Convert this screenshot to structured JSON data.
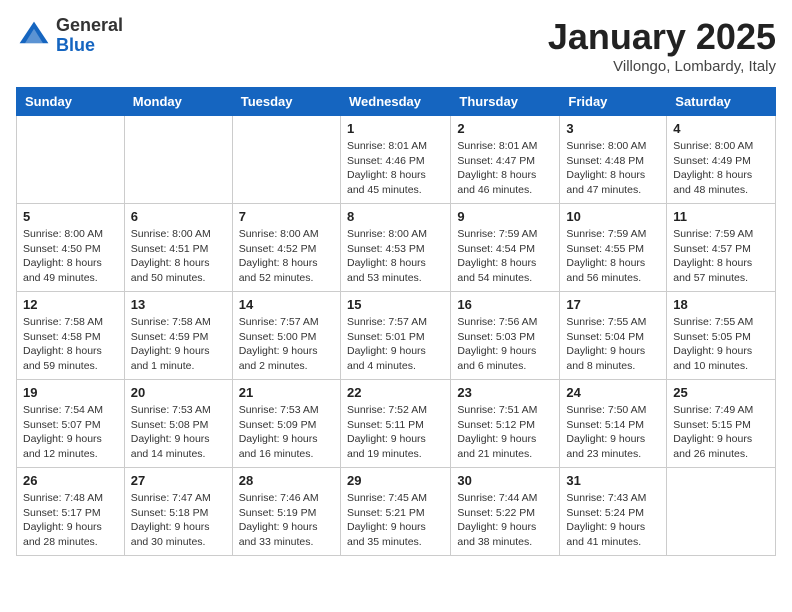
{
  "logo": {
    "general": "General",
    "blue": "Blue"
  },
  "title": "January 2025",
  "location": "Villongo, Lombardy, Italy",
  "days_of_week": [
    "Sunday",
    "Monday",
    "Tuesday",
    "Wednesday",
    "Thursday",
    "Friday",
    "Saturday"
  ],
  "weeks": [
    [
      {
        "num": "",
        "info": ""
      },
      {
        "num": "",
        "info": ""
      },
      {
        "num": "",
        "info": ""
      },
      {
        "num": "1",
        "info": "Sunrise: 8:01 AM\nSunset: 4:46 PM\nDaylight: 8 hours and 45 minutes."
      },
      {
        "num": "2",
        "info": "Sunrise: 8:01 AM\nSunset: 4:47 PM\nDaylight: 8 hours and 46 minutes."
      },
      {
        "num": "3",
        "info": "Sunrise: 8:00 AM\nSunset: 4:48 PM\nDaylight: 8 hours and 47 minutes."
      },
      {
        "num": "4",
        "info": "Sunrise: 8:00 AM\nSunset: 4:49 PM\nDaylight: 8 hours and 48 minutes."
      }
    ],
    [
      {
        "num": "5",
        "info": "Sunrise: 8:00 AM\nSunset: 4:50 PM\nDaylight: 8 hours and 49 minutes."
      },
      {
        "num": "6",
        "info": "Sunrise: 8:00 AM\nSunset: 4:51 PM\nDaylight: 8 hours and 50 minutes."
      },
      {
        "num": "7",
        "info": "Sunrise: 8:00 AM\nSunset: 4:52 PM\nDaylight: 8 hours and 52 minutes."
      },
      {
        "num": "8",
        "info": "Sunrise: 8:00 AM\nSunset: 4:53 PM\nDaylight: 8 hours and 53 minutes."
      },
      {
        "num": "9",
        "info": "Sunrise: 7:59 AM\nSunset: 4:54 PM\nDaylight: 8 hours and 54 minutes."
      },
      {
        "num": "10",
        "info": "Sunrise: 7:59 AM\nSunset: 4:55 PM\nDaylight: 8 hours and 56 minutes."
      },
      {
        "num": "11",
        "info": "Sunrise: 7:59 AM\nSunset: 4:57 PM\nDaylight: 8 hours and 57 minutes."
      }
    ],
    [
      {
        "num": "12",
        "info": "Sunrise: 7:58 AM\nSunset: 4:58 PM\nDaylight: 8 hours and 59 minutes."
      },
      {
        "num": "13",
        "info": "Sunrise: 7:58 AM\nSunset: 4:59 PM\nDaylight: 9 hours and 1 minute."
      },
      {
        "num": "14",
        "info": "Sunrise: 7:57 AM\nSunset: 5:00 PM\nDaylight: 9 hours and 2 minutes."
      },
      {
        "num": "15",
        "info": "Sunrise: 7:57 AM\nSunset: 5:01 PM\nDaylight: 9 hours and 4 minutes."
      },
      {
        "num": "16",
        "info": "Sunrise: 7:56 AM\nSunset: 5:03 PM\nDaylight: 9 hours and 6 minutes."
      },
      {
        "num": "17",
        "info": "Sunrise: 7:55 AM\nSunset: 5:04 PM\nDaylight: 9 hours and 8 minutes."
      },
      {
        "num": "18",
        "info": "Sunrise: 7:55 AM\nSunset: 5:05 PM\nDaylight: 9 hours and 10 minutes."
      }
    ],
    [
      {
        "num": "19",
        "info": "Sunrise: 7:54 AM\nSunset: 5:07 PM\nDaylight: 9 hours and 12 minutes."
      },
      {
        "num": "20",
        "info": "Sunrise: 7:53 AM\nSunset: 5:08 PM\nDaylight: 9 hours and 14 minutes."
      },
      {
        "num": "21",
        "info": "Sunrise: 7:53 AM\nSunset: 5:09 PM\nDaylight: 9 hours and 16 minutes."
      },
      {
        "num": "22",
        "info": "Sunrise: 7:52 AM\nSunset: 5:11 PM\nDaylight: 9 hours and 19 minutes."
      },
      {
        "num": "23",
        "info": "Sunrise: 7:51 AM\nSunset: 5:12 PM\nDaylight: 9 hours and 21 minutes."
      },
      {
        "num": "24",
        "info": "Sunrise: 7:50 AM\nSunset: 5:14 PM\nDaylight: 9 hours and 23 minutes."
      },
      {
        "num": "25",
        "info": "Sunrise: 7:49 AM\nSunset: 5:15 PM\nDaylight: 9 hours and 26 minutes."
      }
    ],
    [
      {
        "num": "26",
        "info": "Sunrise: 7:48 AM\nSunset: 5:17 PM\nDaylight: 9 hours and 28 minutes."
      },
      {
        "num": "27",
        "info": "Sunrise: 7:47 AM\nSunset: 5:18 PM\nDaylight: 9 hours and 30 minutes."
      },
      {
        "num": "28",
        "info": "Sunrise: 7:46 AM\nSunset: 5:19 PM\nDaylight: 9 hours and 33 minutes."
      },
      {
        "num": "29",
        "info": "Sunrise: 7:45 AM\nSunset: 5:21 PM\nDaylight: 9 hours and 35 minutes."
      },
      {
        "num": "30",
        "info": "Sunrise: 7:44 AM\nSunset: 5:22 PM\nDaylight: 9 hours and 38 minutes."
      },
      {
        "num": "31",
        "info": "Sunrise: 7:43 AM\nSunset: 5:24 PM\nDaylight: 9 hours and 41 minutes."
      },
      {
        "num": "",
        "info": ""
      }
    ]
  ]
}
